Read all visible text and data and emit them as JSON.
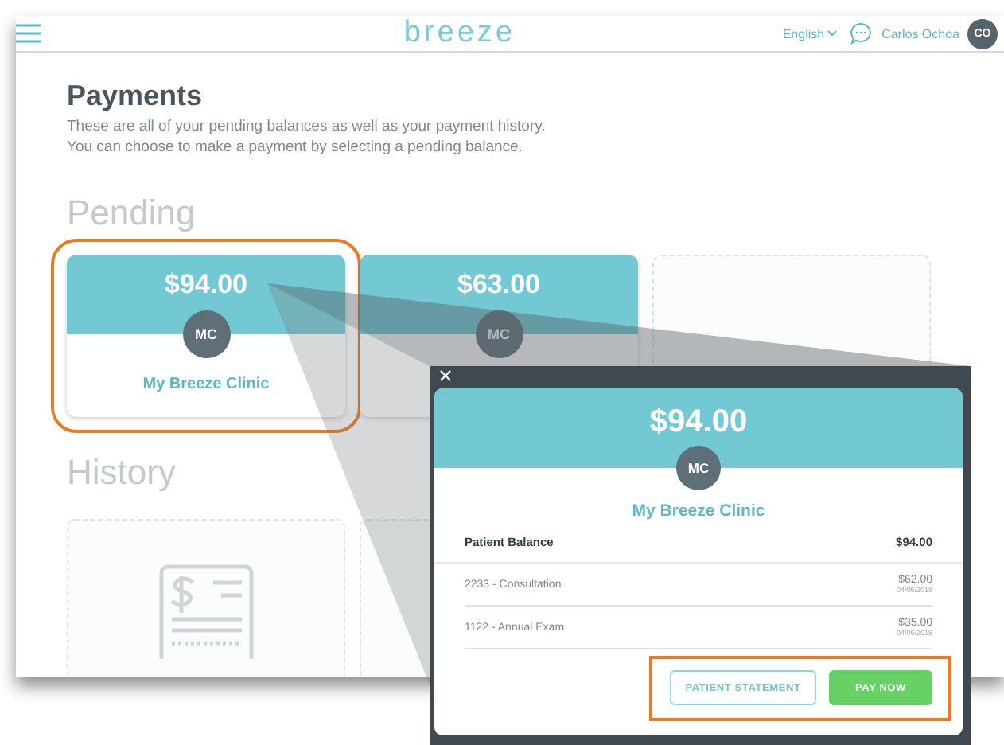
{
  "header": {
    "logo": "breeze",
    "language": "English",
    "user": "Carlos Ochoa",
    "avatar": "CO"
  },
  "page": {
    "title": "Payments",
    "description": "These are all of your pending balances as well as your payment history.\nYou can choose to make a payment by selecting a pending balance."
  },
  "pending": {
    "heading": "Pending",
    "cards": [
      {
        "kind": "balance",
        "amount": "$94.00",
        "initials": "MC",
        "clinic": "My Breeze Clinic",
        "highlighted": true
      },
      {
        "kind": "balance",
        "amount": "$63.00",
        "initials": "MC",
        "highlighted": false
      },
      {
        "kind": "empty"
      }
    ]
  },
  "history": {
    "heading": "History",
    "cards": [
      {
        "kind": "receipt"
      },
      {
        "kind": "empty"
      }
    ]
  },
  "modal": {
    "amount": "$94.00",
    "initials": "MC",
    "clinic": "My Breeze Clinic",
    "balance_label": "Patient Balance",
    "balance_amount": "$94.00",
    "line_items": [
      {
        "description": "2233 - Consultation",
        "amount": "$62.00",
        "date": "04/06/2018"
      },
      {
        "description": "1122 - Annual Exam",
        "amount": "$35.00",
        "date": "04/06/2018"
      }
    ],
    "buttons": [
      {
        "label": "PATIENT STATEMENT",
        "kind": "outline"
      },
      {
        "label": "PAY NOW",
        "kind": "primary"
      }
    ],
    "buttons_highlighted": true
  }
}
